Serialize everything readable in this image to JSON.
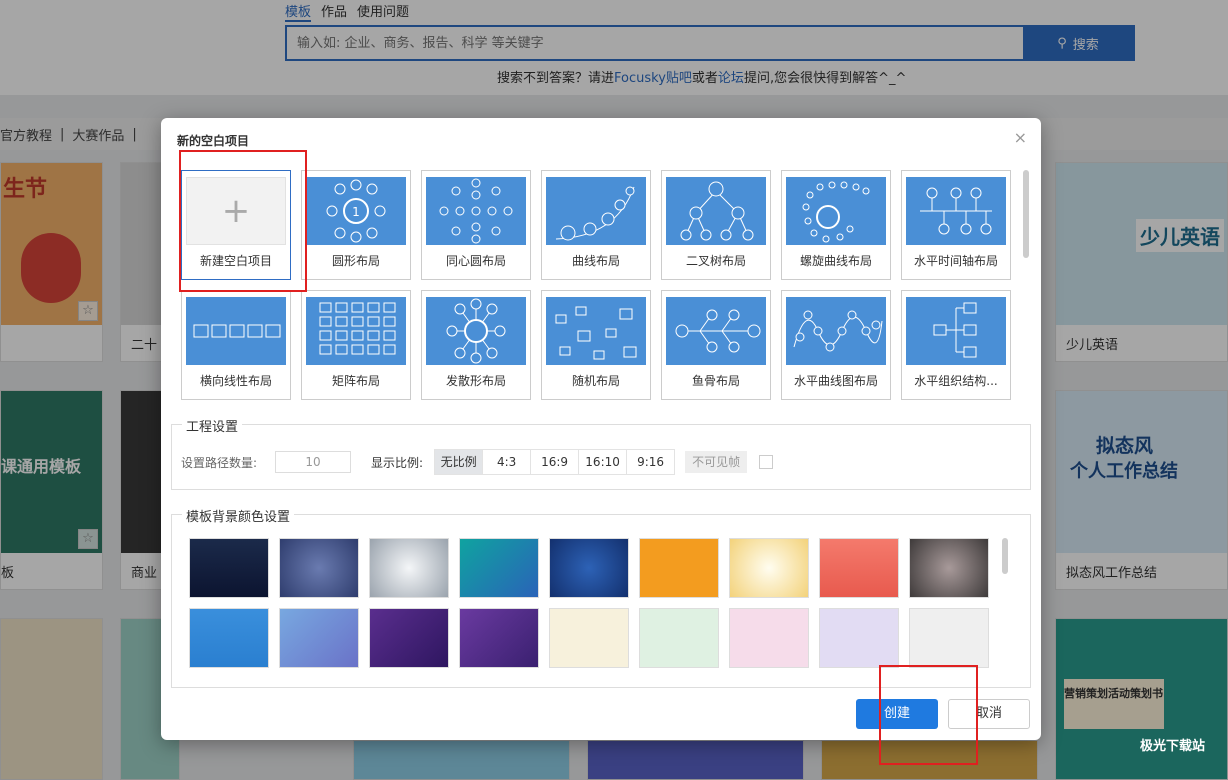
{
  "page": {
    "tabs": [
      "模板",
      "作品",
      "使用问题"
    ],
    "search_placeholder": "输入如: 企业、商务、报告、科学 等关键字",
    "search_button": "搜索",
    "hint_before": "搜索不到答案？请进",
    "hint_link1": "Focusky贴吧",
    "hint_mid": "或者",
    "hint_link2": "论坛",
    "hint_after": "提问,您会很快得到解答^_^",
    "categories": [
      "官方教程",
      "|",
      "大赛作品",
      "|"
    ],
    "cards": [
      {
        "caption": ""
      },
      {
        "caption": "二十"
      },
      {
        "caption": "少儿英语"
      },
      {
        "caption": "板"
      },
      {
        "caption": "商业"
      },
      {
        "caption": "拟态风工作总结"
      }
    ],
    "card_texts": {
      "left_top": "生节",
      "left_mid": "课通用模板",
      "right_top": "少儿英语",
      "right_mid1": "拟态风",
      "right_mid2": "个人工作总结",
      "right_bottom": "营销策划活动策划书"
    },
    "watermark": "极光下载站"
  },
  "dialog": {
    "title": "新的空白项目",
    "close": "×",
    "layouts": [
      {
        "label": "新建空白项目",
        "icon": "+"
      },
      {
        "label": "圆形布局"
      },
      {
        "label": "同心圆布局"
      },
      {
        "label": "曲线布局"
      },
      {
        "label": "二叉树布局"
      },
      {
        "label": "螺旋曲线布局"
      },
      {
        "label": "水平时间轴布局"
      },
      {
        "label": "横向线性布局"
      },
      {
        "label": "矩阵布局"
      },
      {
        "label": "发散形布局"
      },
      {
        "label": "随机布局"
      },
      {
        "label": "鱼骨布局"
      },
      {
        "label": "水平曲线图布局"
      },
      {
        "label": "水平组织结构..."
      }
    ],
    "project_settings": {
      "legend": "工程设置",
      "path_count_label": "设置路径数量:",
      "path_count_value": "10",
      "ratio_label": "显示比例:",
      "ratios": [
        "无比例",
        "4:3",
        "16:9",
        "16:10",
        "9:16"
      ],
      "selected_ratio": "无比例",
      "invisible_frame": "不可见帧"
    },
    "bg_settings": {
      "legend": "模板背景颜色设置",
      "swatches": [
        "linear-gradient(180deg,#1b2a4a,#0c1430)",
        "radial-gradient(circle,#6a7bb0,#2f3d6e)",
        "radial-gradient(circle,#f4f6f8,#9aa3ad)",
        "linear-gradient(135deg,#0fa3a0,#2a63b8)",
        "radial-gradient(circle,#2d62b6,#13306e)",
        "#f39c1f",
        "radial-gradient(circle,#fffdf0,#f3d27a)",
        "linear-gradient(180deg,#f47a6c,#e85a4e)",
        "radial-gradient(circle,#a89a9a,#3e3a3a)",
        "linear-gradient(180deg,#3a8fdc,#2a7fd0)",
        "linear-gradient(135deg,#78a8e0,#6a72c8)",
        "linear-gradient(135deg,#5a2e8e,#2e1660)",
        "linear-gradient(135deg,#6a3aa0,#3a2070)",
        "#f7f1dc",
        "#dff1e2",
        "#f6dcea",
        "#e2dcf3",
        "#efefef"
      ]
    },
    "create_button": "创建",
    "cancel_button": "取消"
  }
}
